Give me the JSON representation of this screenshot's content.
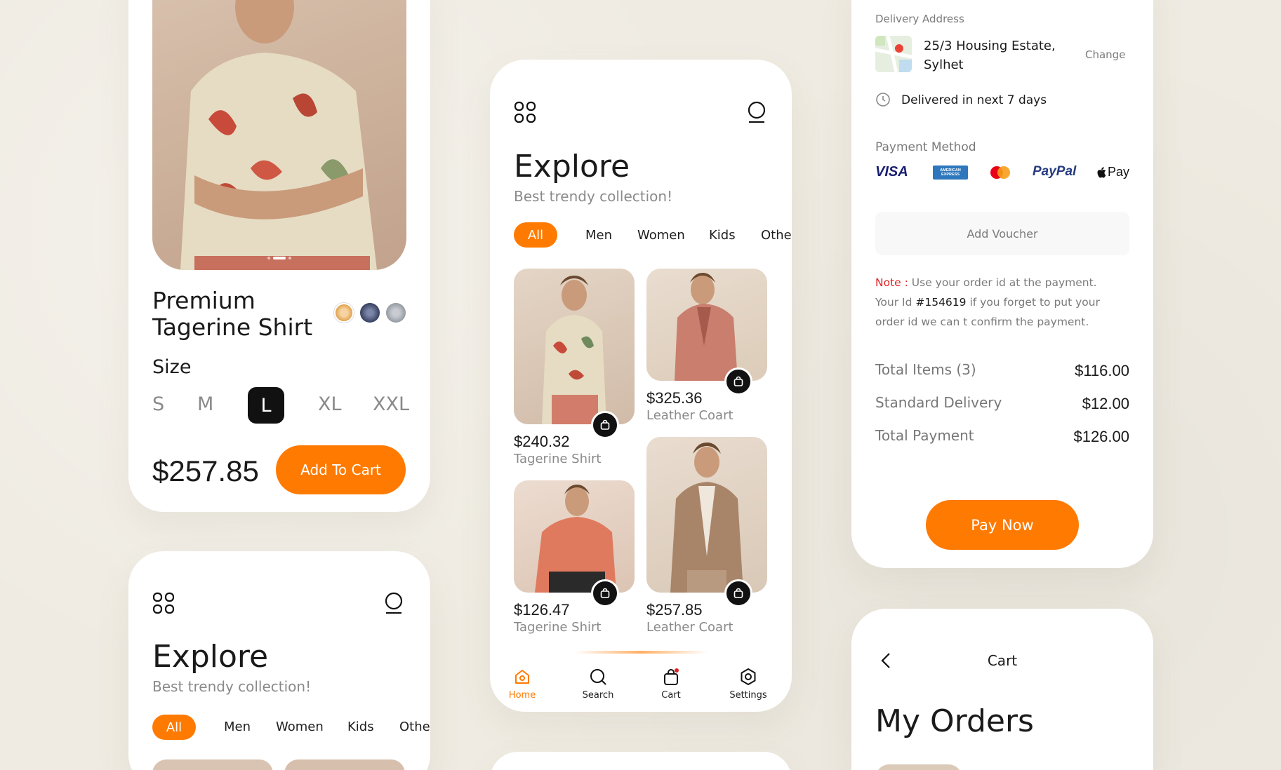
{
  "colors": {
    "accent": "#ff7a00",
    "background": "#efebe2",
    "card": "#ffffff",
    "note": "#e02020"
  },
  "product_card": {
    "title_line1": "Premium",
    "title_line2": "Tagerine Shirt",
    "size_label": "Size",
    "sizes": [
      "S",
      "M",
      "L",
      "XL",
      "XXL"
    ],
    "selected_size": "L",
    "price": "$257.85",
    "add_to_cart_label": "Add To Cart"
  },
  "explore_main": {
    "title": "Explore",
    "subtitle": "Best trendy collection!",
    "categories": [
      "All",
      "Men",
      "Women",
      "Kids",
      "Othe"
    ],
    "selected_category": "All",
    "products": [
      {
        "price": "$240.32",
        "name": "Tagerine Shirt"
      },
      {
        "price": "$325.36",
        "name": "Leather Coart"
      },
      {
        "price": "$126.47",
        "name": "Tagerine Shirt"
      },
      {
        "price": "$257.85",
        "name": "Leather Coart"
      }
    ],
    "nav": [
      {
        "label": "Home",
        "icon": "home-icon",
        "active": true
      },
      {
        "label": "Search",
        "icon": "search-icon",
        "active": false
      },
      {
        "label": "Cart",
        "icon": "cart-bag-icon",
        "active": false
      },
      {
        "label": "Settings",
        "icon": "settings-icon",
        "active": false
      }
    ]
  },
  "explore_small": {
    "title": "Explore",
    "subtitle": "Best trendy collection!",
    "categories": [
      "All",
      "Men",
      "Women",
      "Kids",
      "Othe"
    ]
  },
  "checkout": {
    "delivery_label": "Delivery Address",
    "address_line1": "25/3 Housing Estate,",
    "address_line2": "Sylhet",
    "change_label": "Change",
    "delivery_time": "Delivered in next 7 days",
    "payment_label": "Payment Method",
    "payment_methods": [
      "VISA",
      "AMERICAN EXPRESS",
      "Mastercard",
      "PayPal",
      "Pay"
    ],
    "voucher_label": "Add Voucher",
    "note_label": "Note :",
    "note_text1": " Use your order id at the payment.",
    "note_text2_pre": "Your Id ",
    "note_id": "#154619",
    "note_text2_post": " if you forget to put your",
    "note_text3": "order id we can t confirm the payment.",
    "summary": [
      {
        "label": "Total Items (3)",
        "value": "$116.00"
      },
      {
        "label": "Standard Delivery",
        "value": "$12.00"
      },
      {
        "label": "Total Payment",
        "value": "$126.00"
      }
    ],
    "pay_label": "Pay Now"
  },
  "orders": {
    "header": "Cart",
    "title": "My Orders"
  }
}
